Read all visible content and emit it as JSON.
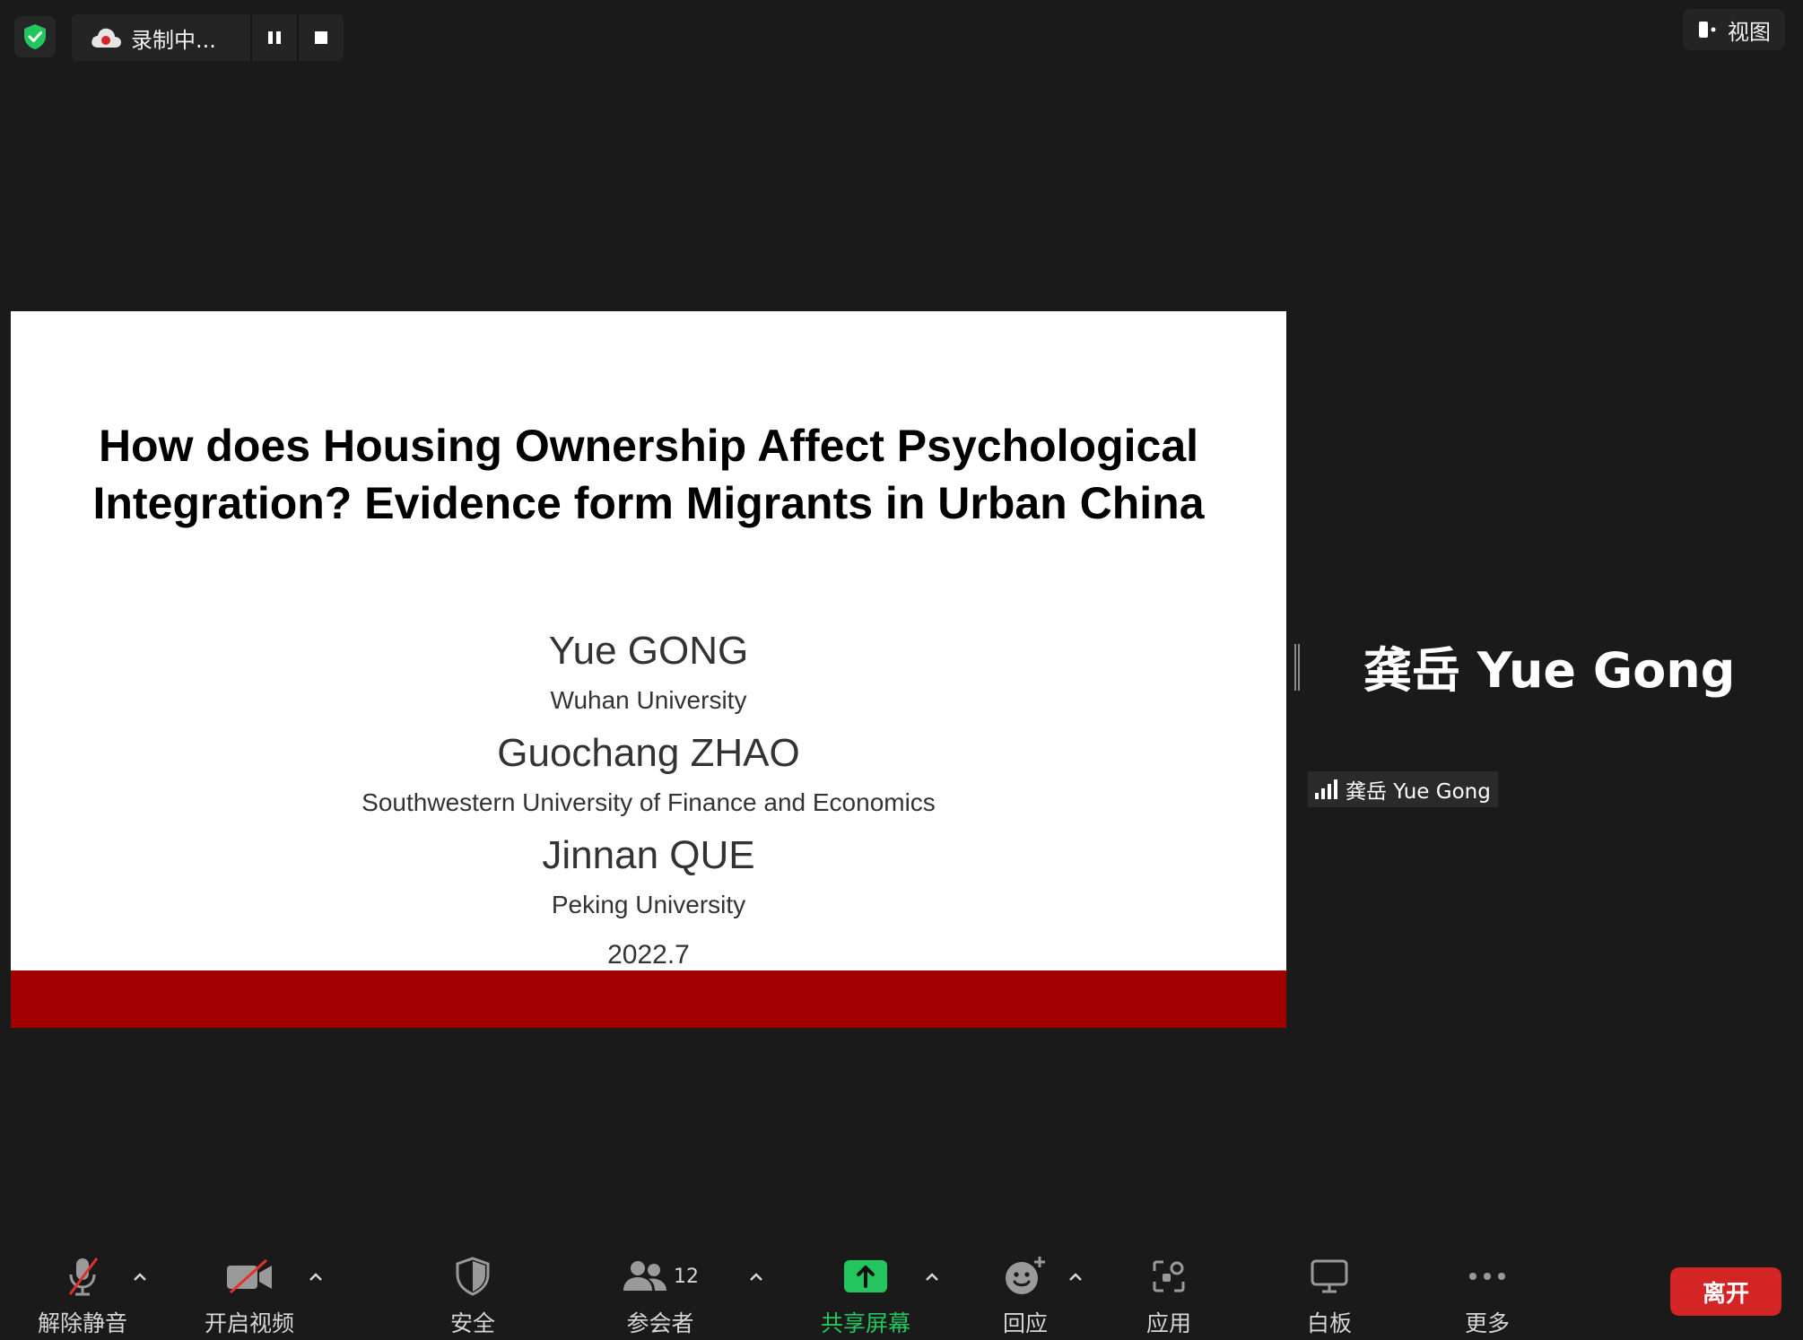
{
  "top_bar": {
    "recording_status": "录制中...",
    "view_label": "视图"
  },
  "slide": {
    "title": "How does Housing Ownership Affect Psychological\nIntegration? Evidence form Migrants in Urban China",
    "authors": [
      {
        "name": "Yue GONG",
        "affiliation": "Wuhan University"
      },
      {
        "name": "Guochang ZHAO",
        "affiliation": "Southwestern University of Finance and Economics"
      },
      {
        "name": "Jinnan QUE",
        "affiliation": "Peking University"
      }
    ],
    "date": "2022.7",
    "accent_color": "#a00000"
  },
  "speaker": {
    "display_name": "龚岳 Yue Gong",
    "label_name": "龚岳 Yue Gong"
  },
  "toolbar": {
    "unmute_label": "解除静音",
    "start_video_label": "开启视频",
    "security_label": "安全",
    "participants_label": "参会者",
    "participants_count": "12",
    "share_screen_label": "共享屏幕",
    "reactions_label": "回应",
    "apps_label": "应用",
    "whiteboard_label": "白板",
    "more_label": "更多",
    "leave_label": "离开",
    "share_color": "#22c55e",
    "leave_color": "#d32525"
  }
}
